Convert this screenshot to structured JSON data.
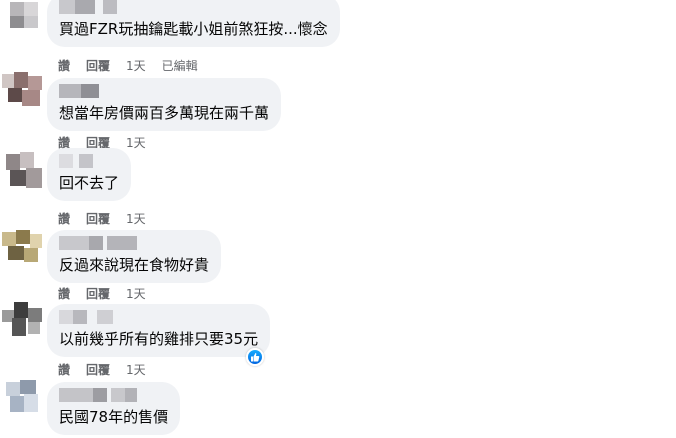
{
  "actions": {
    "read": "讚",
    "reply": "回覆",
    "edited": "已編輯"
  },
  "comments": [
    {
      "text": "買過FZR玩抽鑰匙載小姐前煞狂按...懷念",
      "time": "1天",
      "edited": true
    },
    {
      "text": "想當年房價兩百多萬現在兩千萬",
      "time": "1天"
    },
    {
      "text": "回不去了",
      "time": "1天"
    },
    {
      "text": "反過來說現在食物好貴",
      "time": "1天"
    },
    {
      "text": "以前幾乎所有的雞排只要35元",
      "time": "1天",
      "reaction": "like-icon"
    },
    {
      "text": "民國78年的售價"
    }
  ]
}
